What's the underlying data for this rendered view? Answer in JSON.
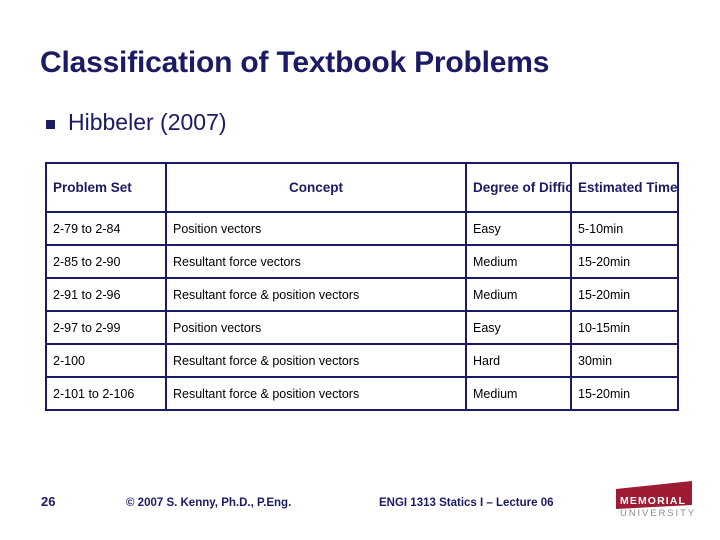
{
  "slide": {
    "title": "Classification of Textbook Problems",
    "bullet": {
      "marker": "square-bullet-icon",
      "text": "Hibbeler (2007)"
    }
  },
  "table": {
    "headers": [
      "Problem Set",
      "Concept",
      "Degree of Difficulty",
      "Estimated Time"
    ],
    "rows": [
      {
        "problem_set": "2-79 to 2-84",
        "concept": "Position vectors",
        "difficulty": "Easy",
        "time": "5-10min"
      },
      {
        "problem_set": "2-85 to 2-90",
        "concept": "Resultant force vectors",
        "difficulty": "Medium",
        "time": "15-20min"
      },
      {
        "problem_set": "2-91 to 2-96",
        "concept": "Resultant force & position vectors",
        "difficulty": "Medium",
        "time": "15-20min"
      },
      {
        "problem_set": "2-97 to 2-99",
        "concept": "Position vectors",
        "difficulty": "Easy",
        "time": "10-15min"
      },
      {
        "problem_set": "2-100",
        "concept": "Resultant force & position vectors",
        "difficulty": "Hard",
        "time": "30min"
      },
      {
        "problem_set": "2-101 to 2-106",
        "concept": "Resultant force & position vectors",
        "difficulty": "Medium",
        "time": "15-20min"
      }
    ]
  },
  "footer": {
    "page_number": "26",
    "copyright": "© 2007 S. Kenny, Ph.D., P.Eng.",
    "course": "ENGI 1313 Statics I – Lecture 06",
    "logo": {
      "name": "memorial-university-logo",
      "wordmark_top": "MEMORIAL",
      "wordmark_bottom": "UNIVERSITY"
    }
  },
  "colors": {
    "navy": "#1b1b64",
    "logo_maroon": "#9e1b34",
    "logo_gray": "#8c8c8c",
    "background": "#ffffff",
    "body_text": "#000000"
  }
}
